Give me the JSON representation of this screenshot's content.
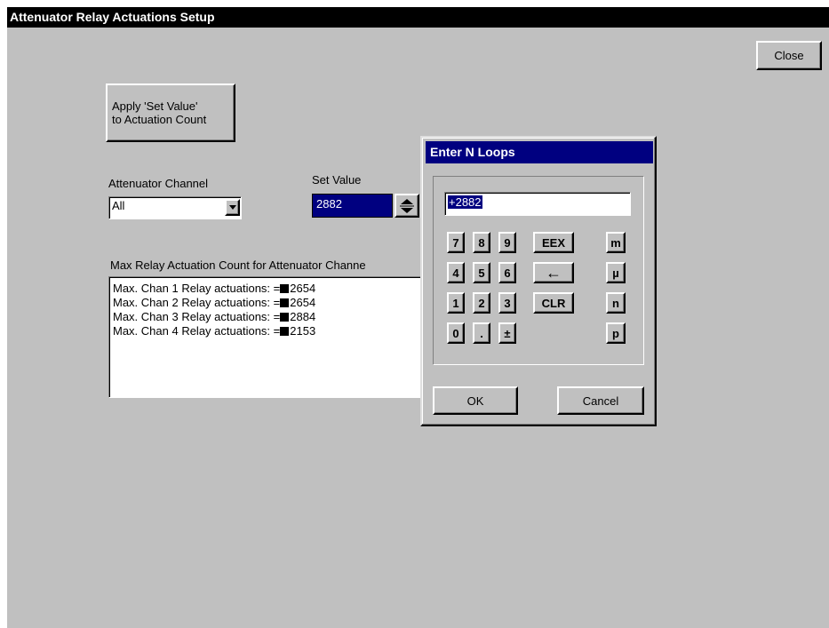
{
  "window": {
    "title": "Attenuator Relay Actuations Setup"
  },
  "close_button": {
    "label": "Close"
  },
  "apply_button": {
    "line1": "Apply 'Set Value'",
    "line2": "to Actuation Count"
  },
  "channel": {
    "label": "Attenuator Channel",
    "value": "All"
  },
  "set_value": {
    "label": "Set Value",
    "value": "2882"
  },
  "max_count": {
    "label": "Max  Relay Actuation Count for Attenuator Channe",
    "lines": [
      {
        "prefix": "Max. Chan 1 Relay actuations: =",
        "value": "2654"
      },
      {
        "prefix": "Max. Chan 2 Relay actuations: =",
        "value": "2654"
      },
      {
        "prefix": "Max. Chan 3 Relay actuations: =",
        "value": "2884"
      },
      {
        "prefix": "Max. Chan 4 Relay actuations: =",
        "value": "2153"
      }
    ]
  },
  "dialog": {
    "title": "Enter N Loops",
    "entry": "+2882",
    "keys": {
      "k7": "7",
      "k8": "8",
      "k9": "9",
      "eex": "EEX",
      "m": "m",
      "k4": "4",
      "k5": "5",
      "k6": "6",
      "backspace": "←",
      "mu": "µ",
      "k1": "1",
      "k2": "2",
      "k3": "3",
      "clr": "CLR",
      "n": "n",
      "k0": "0",
      "dot": ".",
      "plusminus": "±",
      "p": "p"
    },
    "ok": "OK",
    "cancel": "Cancel"
  },
  "colors": {
    "face": "#c0c0c0",
    "selection": "#000080",
    "titlebar": "#000000"
  },
  "icons": {
    "dropdown": "chevron-down-icon",
    "spinner": "spinner-arrows-icon",
    "backspace": "backspace-arrow-icon"
  }
}
